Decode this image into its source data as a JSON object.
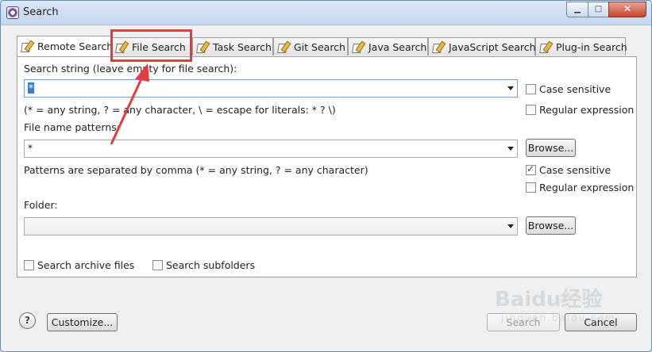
{
  "window": {
    "title": "Search",
    "min_label": "▁",
    "max_label": "□",
    "close_label": "✕"
  },
  "tabs": [
    {
      "label": "Remote Search",
      "active": true
    },
    {
      "label": "File Search",
      "active": false
    },
    {
      "label": "Task Search",
      "active": false
    },
    {
      "label": "Git Search",
      "active": false
    },
    {
      "label": "Java Search",
      "active": false
    },
    {
      "label": "JavaScript Search",
      "active": false
    },
    {
      "label": "Plug-in Search",
      "active": false
    }
  ],
  "search_string": {
    "label": "Search string (leave empty for file search):",
    "value": "*",
    "hint": "(* = any string, ? = any character, \\ = escape for literals: * ? \\)",
    "case_sensitive": {
      "label": "Case sensitive",
      "checked": false
    },
    "regex": {
      "label": "Regular expression",
      "checked": false
    }
  },
  "file_patterns": {
    "label": "File name patterns:",
    "value": "*",
    "browse_label": "Browse...",
    "hint": "Patterns are separated by comma (* = any string, ? = any character)",
    "case_sensitive": {
      "label": "Case sensitive",
      "checked": true
    },
    "regex": {
      "label": "Regular expression",
      "checked": false
    }
  },
  "folder": {
    "label": "Folder:",
    "value": "",
    "browse_label": "Browse..."
  },
  "options": {
    "archive": {
      "label": "Search archive files",
      "checked": false
    },
    "subfolders": {
      "label": "Search subfolders",
      "checked": false
    }
  },
  "footer": {
    "help_label": "?",
    "customize_label": "Customize...",
    "search_label": "Search",
    "cancel_label": "Cancel"
  },
  "watermark": {
    "text": "Baidu经验",
    "sub": "jingyan.baidu.com"
  },
  "colors": {
    "highlight": "#e63b3b",
    "selection": "#3a79d8"
  }
}
